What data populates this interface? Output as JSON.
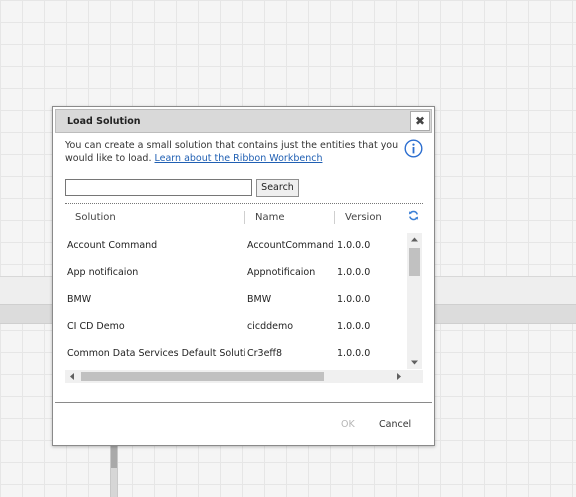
{
  "dialog": {
    "title": "Load Solution",
    "close_glyph": "✖",
    "description": "You can create a small solution that contains just the entities that you would like to load. ",
    "learn_link": "Learn about the Ribbon Workbench",
    "info_icon": "info-icon",
    "search": {
      "value": "",
      "placeholder": ""
    },
    "search_button": "Search",
    "columns": [
      "Solution",
      "Name",
      "Version"
    ],
    "refresh_icon": "refresh-icon",
    "rows": [
      {
        "solution": "Account Command",
        "name": "AccountCommand",
        "version": "1.0.0.0"
      },
      {
        "solution": "App notificaion",
        "name": "Appnotificaion",
        "version": "1.0.0.0"
      },
      {
        "solution": "BMW",
        "name": "BMW",
        "version": "1.0.0.0"
      },
      {
        "solution": "CI CD Demo",
        "name": "cicddemo",
        "version": "1.0.0.0"
      },
      {
        "solution": "Common Data Services Default Solution",
        "name": "Cr3eff8",
        "version": "1.0.0.0"
      }
    ],
    "ok_label": "OK",
    "cancel_label": "Cancel",
    "colors": {
      "link": "#1f5fb3",
      "info": "#2d6fd0",
      "refresh": "#3a7fd5",
      "disabled": "#b5b5b5"
    }
  }
}
